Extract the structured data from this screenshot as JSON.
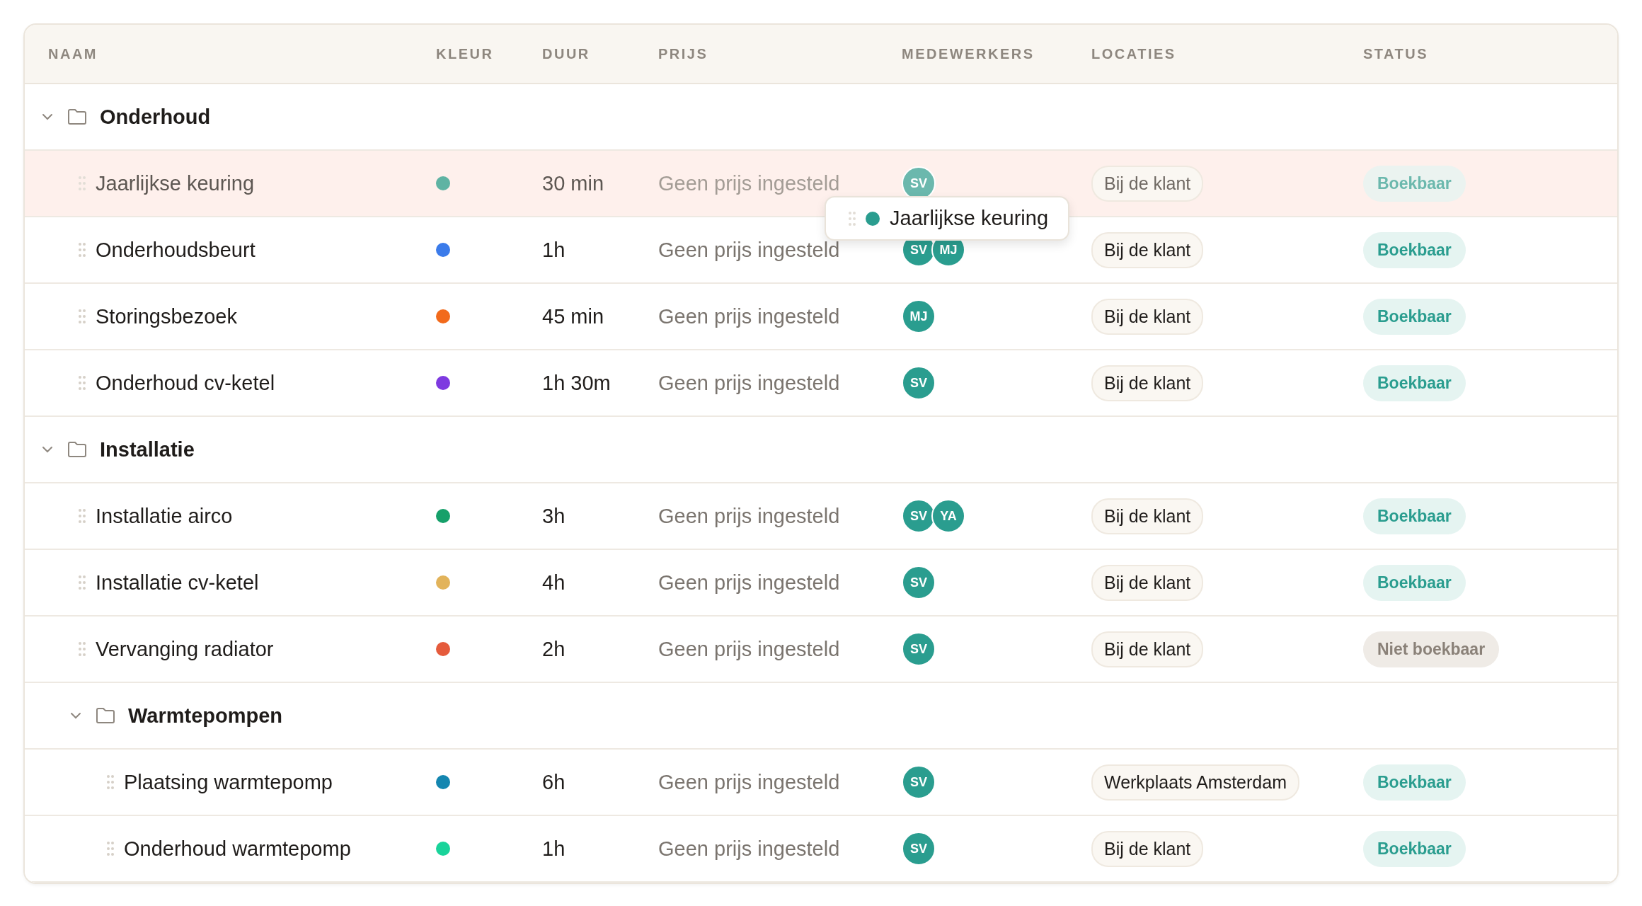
{
  "table": {
    "columns": [
      "NAAM",
      "KLEUR",
      "DUUR",
      "PRIJS",
      "MEDEWERKERS",
      "LOCATIES",
      "STATUS"
    ],
    "rows": [
      {
        "kind": "group",
        "name": "Onderhoud",
        "expanded": true,
        "children": [
          {
            "kind": "service",
            "name": "Jaarlijkse keuring",
            "color": "#5fb3a3",
            "duration": "30 min",
            "price": "Geen prijs ingesteld",
            "staff": [
              "SV"
            ],
            "location": "Bij de klant",
            "status": "Boekbaar",
            "bookable": true,
            "dragging": true
          },
          {
            "kind": "service",
            "name": "Onderhoudsbeurt",
            "color": "#3b7bea",
            "duration": "1h",
            "price": "Geen prijs ingesteld",
            "staff": [
              "SV",
              "MJ"
            ],
            "location": "Bij de klant",
            "status": "Boekbaar",
            "bookable": true,
            "dragging": false
          },
          {
            "kind": "service",
            "name": "Storingsbezoek",
            "color": "#f26a1b",
            "duration": "45 min",
            "price": "Geen prijs ingesteld",
            "staff": [
              "MJ"
            ],
            "location": "Bij de klant",
            "status": "Boekbaar",
            "bookable": true,
            "dragging": false
          },
          {
            "kind": "service",
            "name": "Onderhoud cv-ketel",
            "color": "#7e3ae0",
            "duration": "1h 30m",
            "price": "Geen prijs ingesteld",
            "staff": [
              "SV"
            ],
            "location": "Bij de klant",
            "status": "Boekbaar",
            "bookable": true,
            "dragging": false
          }
        ]
      },
      {
        "kind": "group",
        "name": "Installatie",
        "expanded": true,
        "children": [
          {
            "kind": "service",
            "name": "Installatie airco",
            "color": "#16a06a",
            "duration": "3h",
            "price": "Geen prijs ingesteld",
            "staff": [
              "SV",
              "YA"
            ],
            "location": "Bij de klant",
            "status": "Boekbaar",
            "bookable": true,
            "dragging": false
          },
          {
            "kind": "service",
            "name": "Installatie cv-ketel",
            "color": "#e2b35a",
            "duration": "4h",
            "price": "Geen prijs ingesteld",
            "staff": [
              "SV"
            ],
            "location": "Bij de klant",
            "status": "Boekbaar",
            "bookable": true,
            "dragging": false
          },
          {
            "kind": "service",
            "name": "Vervanging radiator",
            "color": "#e55b3c",
            "duration": "2h",
            "price": "Geen prijs ingesteld",
            "staff": [
              "SV"
            ],
            "location": "Bij de klant",
            "status": "Niet boekbaar",
            "bookable": false,
            "dragging": false
          },
          {
            "kind": "group",
            "name": "Warmtepompen",
            "expanded": true,
            "children": [
              {
                "kind": "service",
                "name": "Plaatsing warmtepomp",
                "color": "#1486b0",
                "duration": "6h",
                "price": "Geen prijs ingesteld",
                "staff": [
                  "SV"
                ],
                "location": "Werkplaats Amsterdam",
                "status": "Boekbaar",
                "bookable": true,
                "dragging": false
              },
              {
                "kind": "service",
                "name": "Onderhoud warmtepomp",
                "color": "#19d39a",
                "duration": "1h",
                "price": "Geen prijs ingesteld",
                "staff": [
                  "SV"
                ],
                "location": "Bij de klant",
                "status": "Boekbaar",
                "bookable": true,
                "dragging": false
              }
            ]
          }
        ]
      }
    ]
  },
  "drag_preview": {
    "name": "Jaarlijkse keuring",
    "color": "#2a9d8f"
  }
}
